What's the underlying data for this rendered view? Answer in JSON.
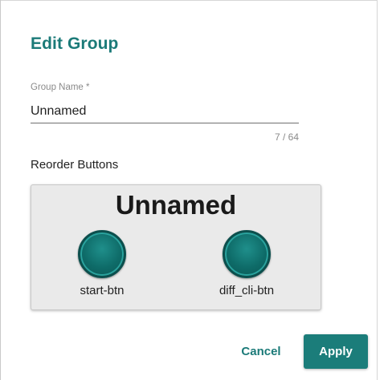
{
  "dialog": {
    "title": "Edit Group",
    "group_name": {
      "label": "Group Name *",
      "value": "Unnamed",
      "counter": "7 / 64"
    },
    "reorder": {
      "label": "Reorder Buttons",
      "group_title": "Unnamed",
      "buttons": [
        {
          "label": "start-btn"
        },
        {
          "label": "diff_cli-btn"
        }
      ]
    },
    "actions": {
      "cancel_label": "Cancel",
      "apply_label": "Apply"
    }
  },
  "colors": {
    "accent": "#1b7a78",
    "button_fill": "#0e6b68",
    "panel_bg": "#eaeaea"
  }
}
